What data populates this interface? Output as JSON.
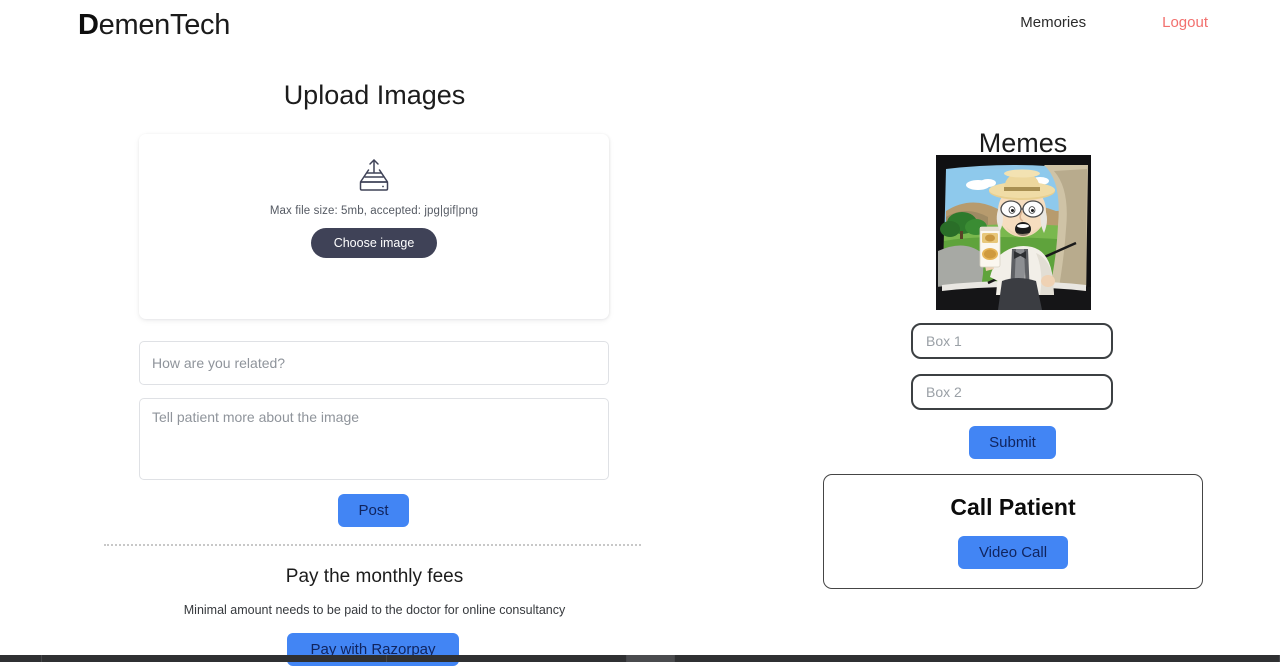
{
  "header": {
    "brand_first_letter": "D",
    "brand_rest": "emenTech",
    "nav": [
      {
        "label": "Memories",
        "name": "nav-link-memories",
        "style": "default"
      },
      {
        "label": "Logout",
        "name": "nav-link-logout",
        "style": "danger"
      }
    ]
  },
  "upload": {
    "title": "Upload Images",
    "icon": "upload-tray-icon",
    "hint": "Max file size: 5mb, accepted: jpg|gif|png",
    "choose_button": "Choose image",
    "relation_placeholder": "How are you related?",
    "relation_value": "",
    "description_placeholder": "Tell patient more about the image",
    "description_value": "",
    "post_button": "Post"
  },
  "payment": {
    "title": "Pay the monthly fees",
    "subtitle": "Minimal amount needs to be paid to the doctor for online consultancy",
    "pay_button": "Pay with Razorpay"
  },
  "memes": {
    "title": "Memes",
    "image_alt": "pepperidge-farm-remembers-meme",
    "box1_placeholder": "Box 1",
    "box1_value": "",
    "box2_placeholder": "Box 2",
    "box2_value": "",
    "submit_button": "Submit"
  },
  "call": {
    "title": "Call Patient",
    "video_button": "Video Call"
  },
  "colors": {
    "primary_blue": "#4285f4",
    "button_text_navy": "#10245e",
    "choose_image_navy": "#3f4257",
    "logout_red": "#f2706e",
    "text_dark": "#1c1c1c",
    "placeholder_grey": "#8f949b",
    "input_border": "#dfe1e5",
    "box_border": "#3c4043",
    "divider_dotted": "#c8c8c8",
    "taskbar": "#2f3032"
  }
}
